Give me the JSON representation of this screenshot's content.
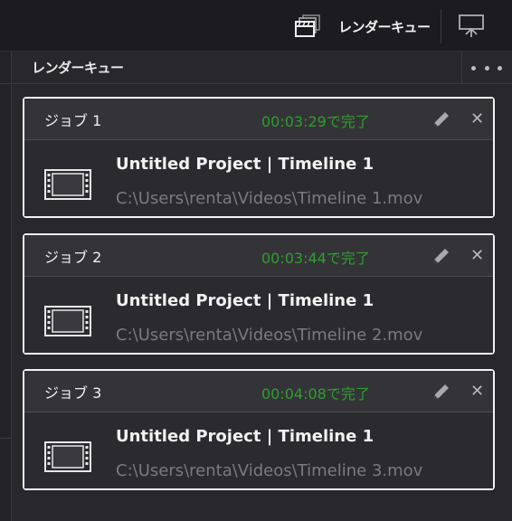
{
  "topbar": {
    "render_queue_label": "レンダーキュー"
  },
  "panel": {
    "title": "レンダーキュー"
  },
  "jobs": [
    {
      "name": "ジョブ 1",
      "status": "00:03:29で完了",
      "title": "Untitled Project | Timeline 1",
      "path": "C:\\Users\\renta\\Videos\\Timeline 1.mov"
    },
    {
      "name": "ジョブ 2",
      "status": "00:03:44で完了",
      "title": "Untitled Project | Timeline 1",
      "path": "C:\\Users\\renta\\Videos\\Timeline 2.mov"
    },
    {
      "name": "ジョブ 3",
      "status": "00:04:08で完了",
      "title": "Untitled Project | Timeline 1",
      "path": "C:\\Users\\renta\\Videos\\Timeline 3.mov"
    }
  ],
  "colors": {
    "background": "#1f1f23",
    "panel": "#28282c",
    "status_complete": "#2f9e2f",
    "path_text": "#7a7a7f",
    "selected_border": "#f2f2f2"
  },
  "icons": {
    "render_queue": "clapperboard-stack-icon",
    "monitor": "monitor-icon",
    "more": "more-options-icon",
    "edit": "pencil-icon",
    "close": "close-icon",
    "film": "film-strip-icon"
  }
}
